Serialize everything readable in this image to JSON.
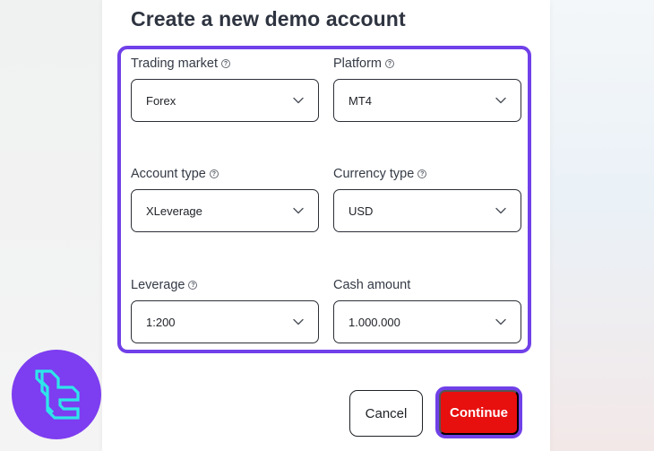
{
  "form": {
    "title": "Create a new demo account",
    "fields": [
      {
        "label": "Trading market",
        "value": "Forex",
        "has_help": true
      },
      {
        "label": "Platform",
        "value": "MT4",
        "has_help": true
      },
      {
        "label": "Account type",
        "value": "XLeverage",
        "has_help": true
      },
      {
        "label": "Currency type",
        "value": "USD",
        "has_help": true
      },
      {
        "label": "Leverage",
        "value": "1:200",
        "has_help": true
      },
      {
        "label": "Cash amount",
        "value": "1.000.000",
        "has_help": false
      }
    ],
    "help_glyph": "?"
  },
  "actions": {
    "cancel_label": "Cancel",
    "continue_label": "Continue"
  },
  "colors": {
    "highlight": "#7040e8",
    "continue_bg": "#e80f0f",
    "logo_bg": "#7d3df0",
    "logo_mark": "#2ee6ea"
  },
  "icons": {
    "select_arrow": "chevron-down-icon",
    "help": "question-circle-icon",
    "logo": "brand-logo-icon"
  }
}
